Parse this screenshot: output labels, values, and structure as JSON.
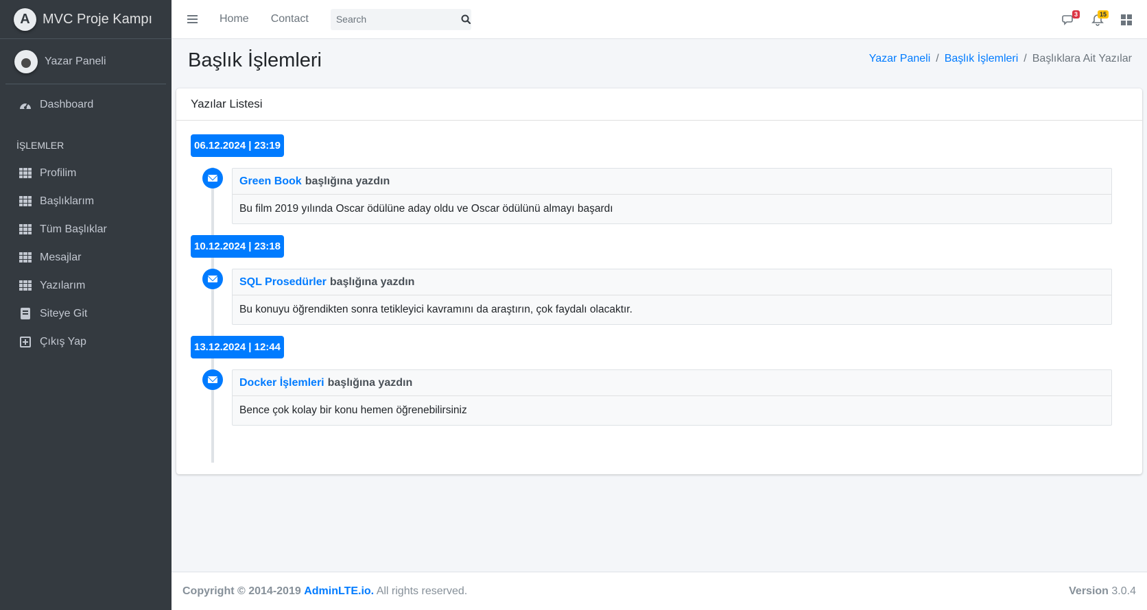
{
  "brand": {
    "title": "MVC Proje Kampı"
  },
  "user": {
    "name": "Yazar Paneli"
  },
  "sidebar": {
    "dashboard_label": "Dashboard",
    "section_header": "İŞLEMLER",
    "items": [
      {
        "label": "Profilim",
        "icon": "grid-icon"
      },
      {
        "label": "Başlıklarım",
        "icon": "grid-icon"
      },
      {
        "label": "Tüm Başlıklar",
        "icon": "grid-icon"
      },
      {
        "label": "Mesajlar",
        "icon": "grid-icon"
      },
      {
        "label": "Yazılarım",
        "icon": "grid-icon"
      },
      {
        "label": "Siteye Git",
        "icon": "book-icon"
      },
      {
        "label": "Çıkış Yap",
        "icon": "plus-square-icon"
      }
    ]
  },
  "topbar": {
    "home_label": "Home",
    "contact_label": "Contact",
    "search_placeholder": "Search",
    "messages_count": "3",
    "notifications_count": "15"
  },
  "page": {
    "title": "Başlık İşlemleri",
    "breadcrumb": [
      "Yazar Paneli",
      "Başlık İşlemleri",
      "Başlıklara Ait Yazılar"
    ]
  },
  "card": {
    "title": "Yazılar Listesi",
    "entries": [
      {
        "date": "06.12.2024 | 23:19",
        "heading_link": "Green Book",
        "heading_suffix": "başlığına yazdın",
        "body": "Bu film 2019 yılında Oscar ödülüne aday oldu ve Oscar ödülünü almayı başardı"
      },
      {
        "date": "10.12.2024 | 23:18",
        "heading_link": "SQL Prosedürler",
        "heading_suffix": "başlığına yazdın",
        "body": "Bu konuyu öğrendikten sonra tetikleyici kavramını da araştırın, çok faydalı olacaktır."
      },
      {
        "date": "13.12.2024 | 12:44",
        "heading_link": "Docker İşlemleri",
        "heading_suffix": "başlığına yazdın",
        "body": "Bence çok kolay bir konu hemen öğrenebilirsiniz"
      }
    ]
  },
  "footer": {
    "copyright_prefix": "Copyright © 2014-2019",
    "copyright_link": "AdminLTE.io.",
    "copyright_suffix": "All rights reserved.",
    "version_label": "Version",
    "version_value": "3.0.4"
  },
  "colors": {
    "accent": "#007bff",
    "sidebar_bg": "#343a40",
    "badge_danger": "#dc3545",
    "badge_warning": "#ffc107"
  }
}
